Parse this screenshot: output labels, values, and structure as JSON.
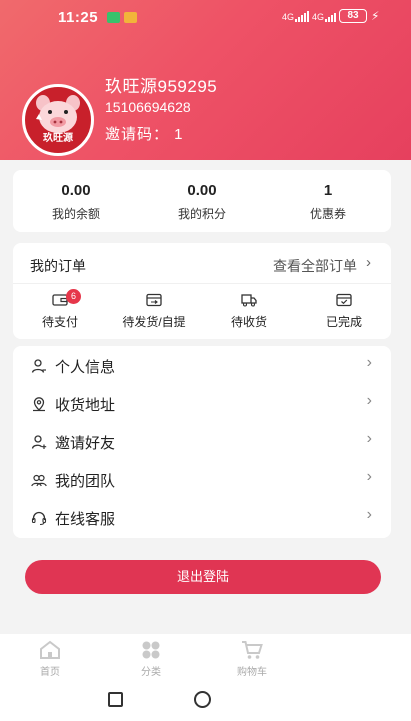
{
  "status": {
    "time": "11:25",
    "network1": "4G",
    "network2": "4G",
    "battery": "83"
  },
  "profile": {
    "avatar_text": "玖旺源",
    "username": "玖旺源959295",
    "phone": "15106694628",
    "invite": "邀请码： 1"
  },
  "stats": [
    {
      "value": "0.00",
      "label": "我的余额"
    },
    {
      "value": "0.00",
      "label": "我的积分"
    },
    {
      "value": "1",
      "label": "优惠券"
    }
  ],
  "orders": {
    "title": "我的订单",
    "view_all": "查看全部订单",
    "items": [
      {
        "label": "待支付",
        "icon": "wallet-icon",
        "badge": "6"
      },
      {
        "label": "待发货/自提",
        "icon": "box-arrow-icon"
      },
      {
        "label": "待收货",
        "icon": "truck-icon"
      },
      {
        "label": "已完成",
        "icon": "box-check-icon"
      }
    ]
  },
  "menu": [
    {
      "label": "个人信息",
      "icon": "user-icon"
    },
    {
      "label": "收货地址",
      "icon": "location-icon"
    },
    {
      "label": "邀请好友",
      "icon": "add-user-icon"
    },
    {
      "label": "我的团队",
      "icon": "team-icon"
    },
    {
      "label": "在线客服",
      "icon": "headset-icon"
    }
  ],
  "logout_label": "退出登陆",
  "tabs": [
    {
      "label": "首页",
      "icon": "home-icon"
    },
    {
      "label": "分类",
      "icon": "category-icon"
    },
    {
      "label": "购物车",
      "icon": "cart-icon"
    }
  ],
  "colors": {
    "brand": "#ee5266",
    "button": "#e03553"
  }
}
